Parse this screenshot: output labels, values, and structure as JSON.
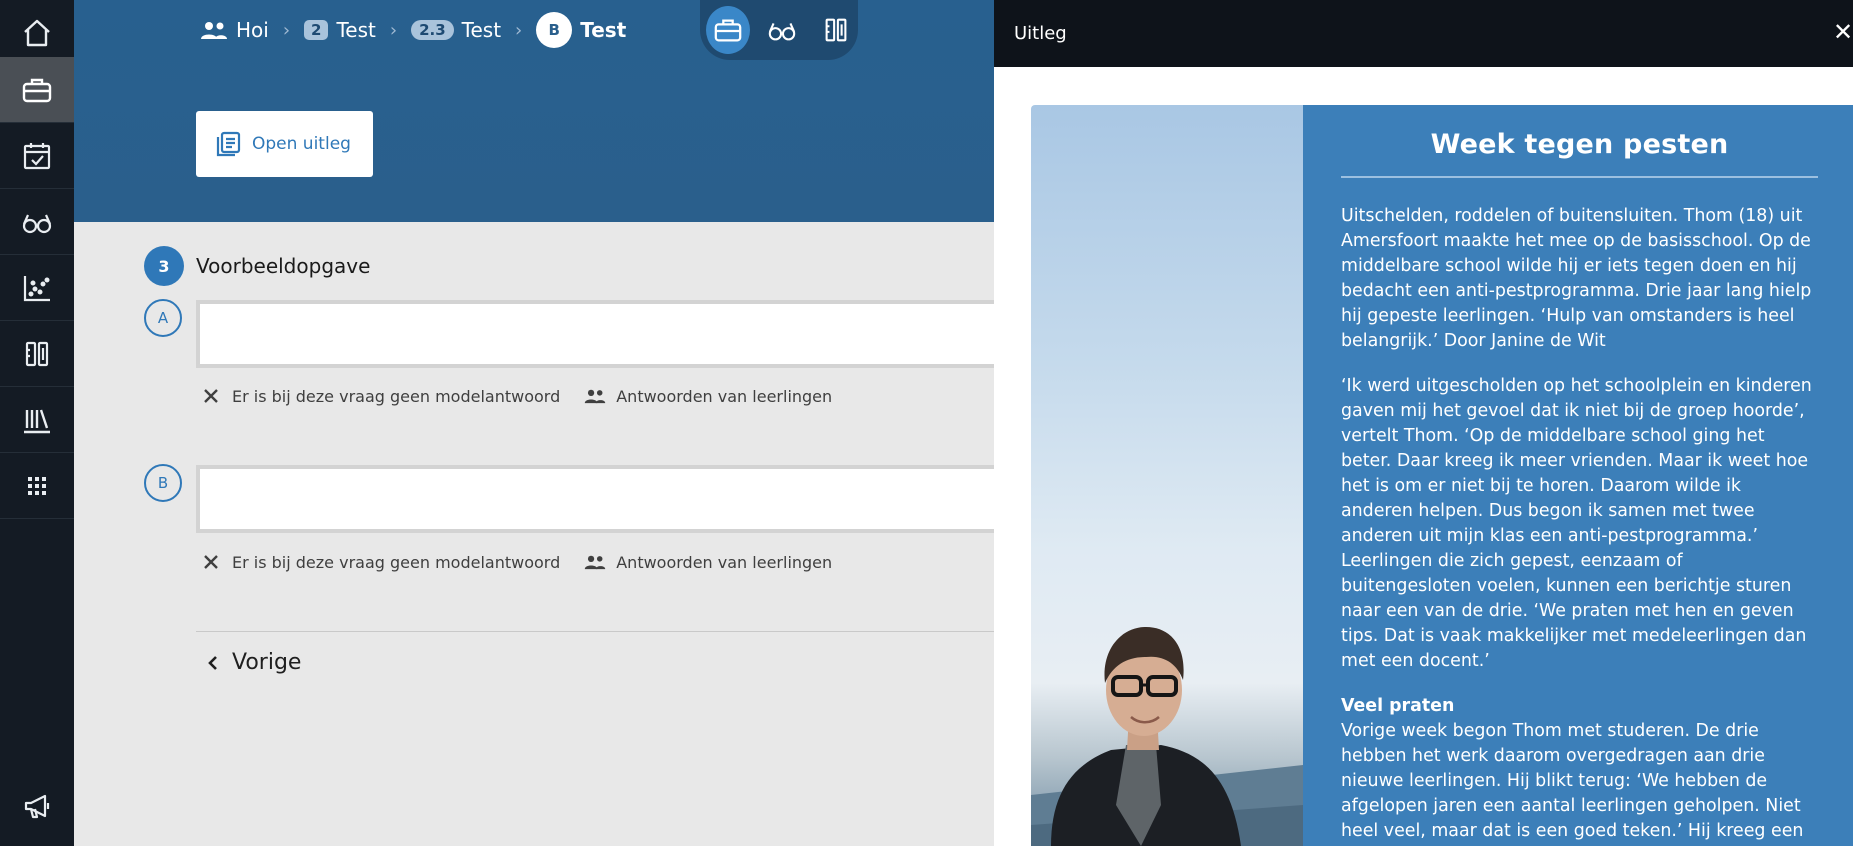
{
  "sidebar": {
    "items": [
      {
        "icon": "home-icon"
      },
      {
        "icon": "briefcase-icon",
        "active": true
      },
      {
        "icon": "calendar-check-icon"
      },
      {
        "icon": "glasses-icon"
      },
      {
        "icon": "chart-scatter-icon"
      },
      {
        "icon": "tools-icon"
      },
      {
        "icon": "library-icon"
      },
      {
        "icon": "apps-grid-icon"
      }
    ],
    "bottom_icon": "megaphone-icon"
  },
  "breadcrumb": {
    "items": [
      {
        "badge": "",
        "label": "Hoi",
        "icon": "group-icon"
      },
      {
        "badge": "2",
        "label": "Test"
      },
      {
        "badge": "2.3",
        "label": "Test"
      },
      {
        "badge": "B",
        "label": "Test"
      }
    ]
  },
  "toolbar": {
    "tools": [
      "briefcase-icon",
      "glasses-icon",
      "tools-icon"
    ]
  },
  "open_button": {
    "label": "Open uitleg",
    "icon": "book-icon"
  },
  "question": {
    "number": "3",
    "title": "Voorbeeldopgave",
    "parts": [
      {
        "letter": "A",
        "no_model": "Er is bij deze vraag geen modelantwoord",
        "student_answers": "Antwoorden van leerlingen"
      },
      {
        "letter": "B",
        "no_model": "Er is bij deze vraag geen modelantwoord",
        "student_answers": "Antwoorden van leerlingen"
      }
    ]
  },
  "nav": {
    "prev_label": "Vorige"
  },
  "panel": {
    "title": "Uitleg",
    "close": "✕",
    "article": {
      "heading": "Week tegen pesten",
      "intro": "Uitschelden, roddelen of buitensluiten. Thom (18) uit Amersfoort maakte het mee op de basisschool. Op de middelbare school wilde hij er iets tegen doen en hij bedacht een anti-pestprogramma. Drie jaar lang hielp hij gepeste leerlingen. ‘Hulp van omstanders is heel belangrijk.’ Door Janine de Wit",
      "body": "‘Ik werd uitgescholden op het schoolplein en kinderen gaven mij het gevoel dat ik niet bij de groep hoorde’, vertelt Thom. ‘Op de middelbare school ging het beter. Daar kreeg ik meer vrienden. Maar ik weet hoe het is om er niet bij te horen. Daarom wilde ik anderen helpen. Dus begon ik samen met twee anderen uit mijn klas een anti-pestprogramma.’ Leerlingen die zich gepest, eenzaam of buitengesloten voelen, kunnen een berichtje sturen naar een van de drie. ‘We praten met hen en geven tips. Dat is vaak makkelijker met medeleerlingen dan met een docent.’",
      "subheading": "Veel praten",
      "body2": "Vorige week begon Thom met studeren. De drie hebben het werk daarom overgedragen aan drie nieuwe leerlingen. Hij blikt terug: ‘We hebben de afgelopen jaren een aantal leerlingen geholpen. Niet heel veel, maar dat is een goed teken.’ Hij kreeg een"
    }
  }
}
